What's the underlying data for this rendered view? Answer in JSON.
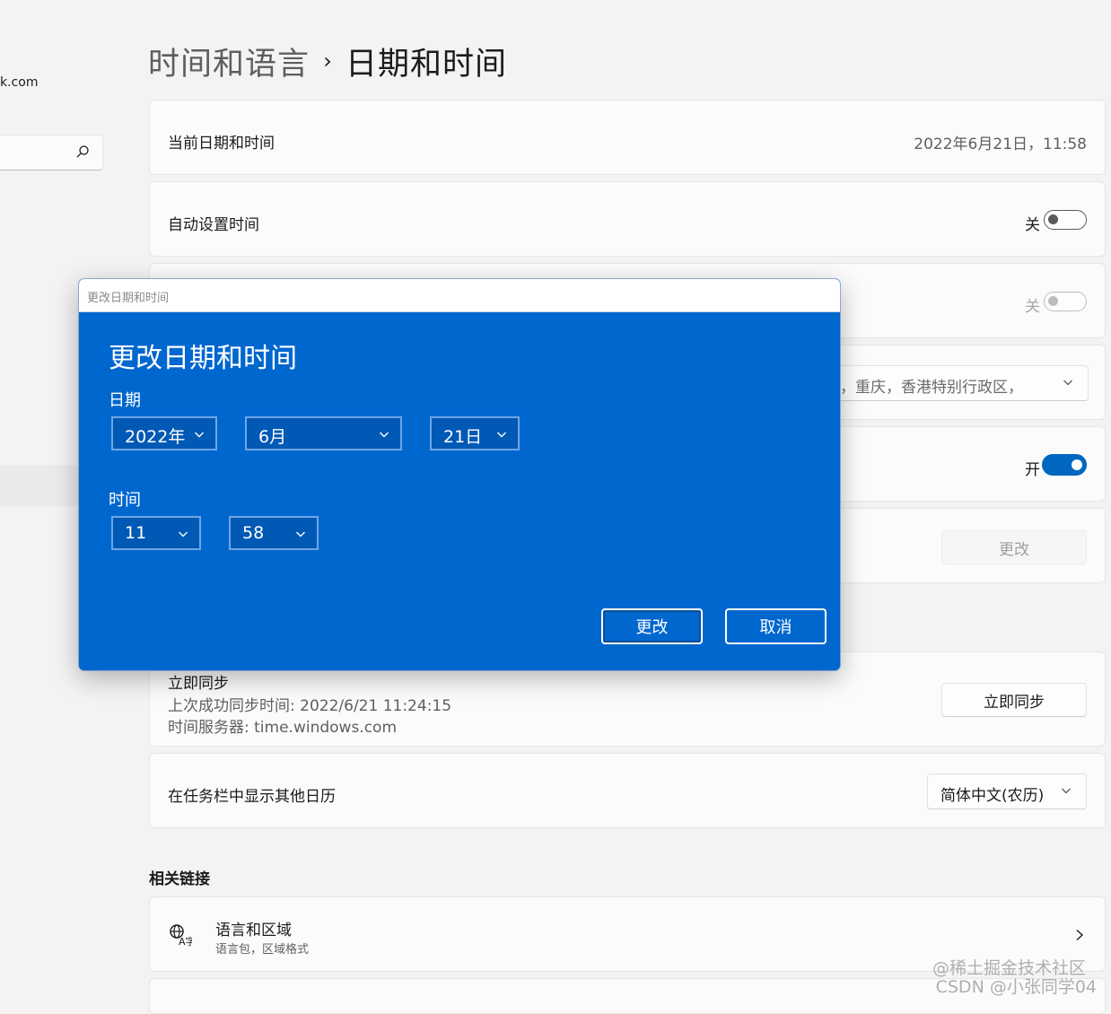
{
  "sidebar": {
    "account_email_fragment": "k.com"
  },
  "breadcrumb": {
    "parent": "时间和语言",
    "separator": "›",
    "current": "日期和时间"
  },
  "settings": {
    "current_datetime": {
      "label": "当前日期和时间",
      "value": "2022年6月21日，11:58"
    },
    "auto_time": {
      "label": "自动设置时间",
      "state": "关"
    },
    "auto_timezone": {
      "state": "关"
    },
    "timezone": {
      "value_fragment": "北京，重庆，香港特别行政区，"
    },
    "dst": {
      "state": "开"
    },
    "manual_change": {
      "button": "更改"
    },
    "sync": {
      "title": "立即同步",
      "last_sync": "上次成功同步时间: 2022/6/21 11:24:15",
      "server": "时间服务器: time.windows.com",
      "button": "立即同步"
    },
    "calendar": {
      "label": "在任务栏中显示其他日历",
      "value": "简体中文(农历)"
    }
  },
  "related": {
    "title": "相关链接",
    "items": [
      {
        "title": "语言和区域",
        "subtitle": "语言包，区域格式"
      }
    ]
  },
  "dialog": {
    "window_title": "更改日期和时间",
    "heading": "更改日期和时间",
    "date_label": "日期",
    "year": "2022年",
    "month": "6月",
    "day": "21日",
    "time_label": "时间",
    "hour": "11",
    "minute": "58",
    "confirm": "更改",
    "cancel": "取消"
  },
  "watermark": {
    "line1": "@稀土掘金技术社区",
    "line2": "CSDN @小张同学04"
  },
  "colors": {
    "accent": "#0067c0",
    "dialog_background": "#0067cf"
  }
}
